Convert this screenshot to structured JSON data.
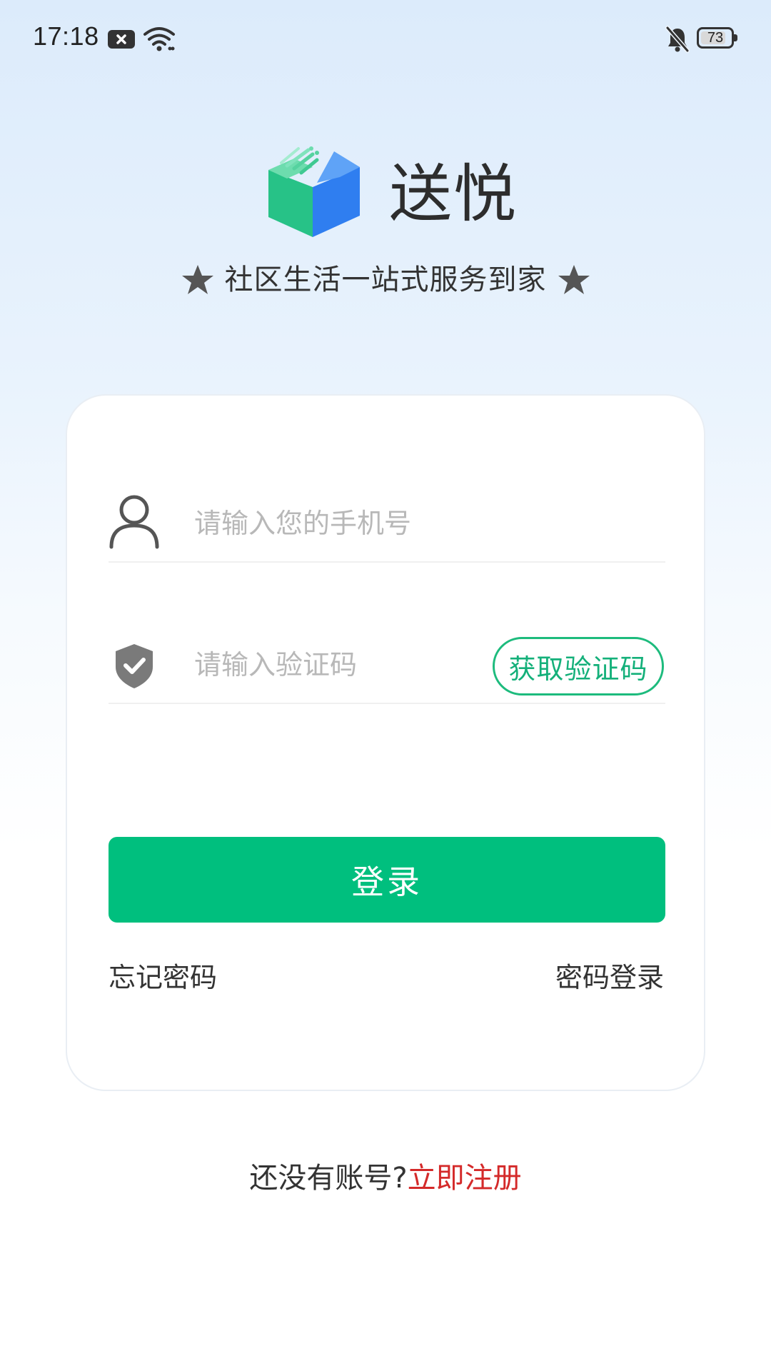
{
  "status_bar": {
    "time": "17:18",
    "battery_level": "73",
    "battery_fraction": 0.73
  },
  "brand": {
    "name": "送悦",
    "tagline": "社区生活一站式服务到家",
    "colors": {
      "logo_green": "#2fc98a",
      "logo_blue": "#2f7ef0",
      "accent": "#00bf7e"
    }
  },
  "form": {
    "phone_placeholder": "请输入您的手机号",
    "phone_icon": "user-icon",
    "code_placeholder": "请输入验证码",
    "code_icon": "shield-check-icon",
    "get_code_label": "获取验证码",
    "login_label": "登录",
    "forgot_password_label": "忘记密码",
    "password_login_label": "密码登录"
  },
  "register": {
    "prompt": "还没有账号?",
    "link_label": "立即注册",
    "link_color": "#d42a2a"
  }
}
